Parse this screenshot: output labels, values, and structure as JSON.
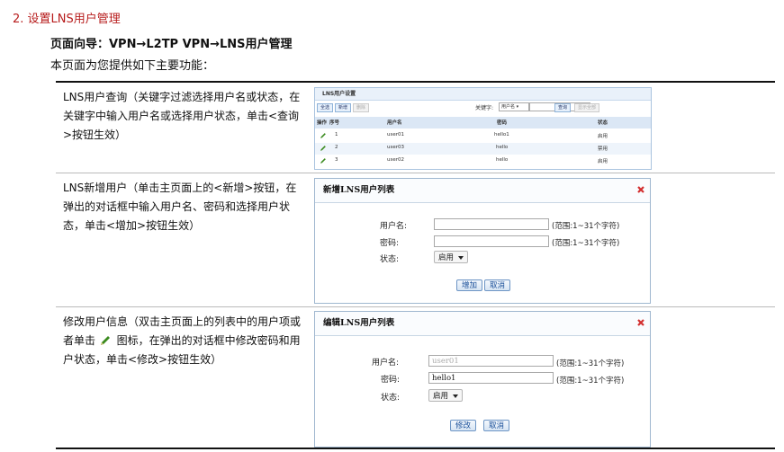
{
  "section_title": "2. 设置LNS用户管理",
  "nav_path": "页面向导：VPN→L2TP VPN→LNS用户管理",
  "intro": "本页面为您提供如下主要功能：",
  "rows": [
    {
      "desc_lines": [
        "LNS用户查询（关键字过滤选择用户名或状态，在",
        "关键字中输入用户名或选择用户状态，单击<查询",
        ">按钮生效）"
      ]
    },
    {
      "desc_lines": [
        "LNS新增用户（单击主页面上的<新增>按钮，在",
        "弹出的对话框中输入用户名、密码和选择用户状",
        "态，单击<增加>按钮生效）"
      ]
    },
    {
      "desc_lines_1": "修改用户信息（双击主页面上的列表中的用户项或",
      "desc_line_2_pre": "者单击",
      "desc_line_2_post": "图标，在弹出的对话框中修改密码和用",
      "desc_line_3": "户状态，单击<修改>按钮生效）"
    }
  ],
  "list_panel": {
    "title": "LNS用户设置",
    "buttons": [
      "全选",
      "新增",
      "删除"
    ],
    "keyword_label": "关键字:",
    "keyword_select": "用户名",
    "query_button": "查询",
    "show_all_button": "显示全部",
    "headers": [
      "操作",
      "序号",
      "用户名",
      "密码",
      "状态"
    ],
    "users": [
      {
        "no": "1",
        "name": "user01",
        "password": "hello1",
        "status": "启用"
      },
      {
        "no": "2",
        "name": "user03",
        "password": "hello",
        "status": "禁用"
      },
      {
        "no": "3",
        "name": "user02",
        "password": "hello",
        "status": "启用"
      }
    ]
  },
  "add_dialog": {
    "title": "新增LNS用户列表",
    "username_label": "用户名:",
    "password_label": "密码:",
    "status_label": "状态:",
    "username_hint": "(范围:1~31个字符)",
    "password_hint": "(范围:1~31个字符)",
    "status_value": "启用",
    "add_button": "增加",
    "cancel_button": "取消"
  },
  "edit_dialog": {
    "title": "编辑LNS用户列表",
    "username_label": "用户名:",
    "password_label": "密码:",
    "status_label": "状态:",
    "username_value": "user01",
    "password_value": "hello1",
    "username_hint": "(范围:1~31个字符)",
    "password_hint": "(范围:1~31个字符)",
    "status_value": "启用",
    "modify_button": "修改",
    "cancel_button": "取消"
  },
  "colors": {
    "section_title": "#b71c1c",
    "close_icon": "#d32f2f",
    "pencil_icon": "#3a8a1e"
  }
}
